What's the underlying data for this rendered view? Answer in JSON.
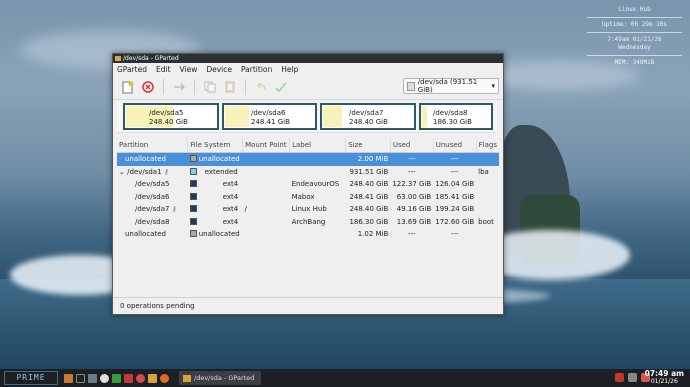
{
  "conky": {
    "host": "Linux Hub",
    "uptime": "Uptime: 0h 29m 10s",
    "time_date": "7:49am  01/21/26",
    "weekday": "Wednesday",
    "mem": "MEM: 340MiB"
  },
  "window": {
    "title": "/dev/sda - GParted",
    "menu": [
      "GParted",
      "Edit",
      "View",
      "Device",
      "Partition",
      "Help"
    ],
    "device_selector": "/dev/sda (931.51 GiB)"
  },
  "diskmap": [
    {
      "name": "/dev/sda5",
      "size": "248.40 GiB",
      "used_fraction": 0.49
    },
    {
      "name": "/dev/sda6",
      "size": "248.41 GiB",
      "used_fraction": 0.25
    },
    {
      "name": "/dev/sda7",
      "size": "248.40 GiB",
      "used_fraction": 0.2
    },
    {
      "name": "/dev/sda8",
      "size": "186.30 GiB",
      "used_fraction": 0.07
    }
  ],
  "table": {
    "headers": [
      "Partition",
      "File System",
      "Mount Point",
      "Label",
      "Size",
      "Used",
      "Unused",
      "Flags"
    ],
    "rows": [
      {
        "partition": "unallocated",
        "fs": "unallocated",
        "fs_color": "#a8a8a8",
        "mount": "",
        "label": "",
        "size": "2.00 MiB",
        "used": "---",
        "unused": "---",
        "flags": ""
      },
      {
        "partition": "/dev/sda1",
        "fs": "extended",
        "fs_color": "#7dd5e8",
        "mount": "",
        "label": "",
        "size": "931.51 GiB",
        "used": "---",
        "unused": "---",
        "flags": "lba"
      },
      {
        "partition": "/dev/sda5",
        "fs": "ext4",
        "fs_color": "#1f3a5a",
        "mount": "",
        "label": "EndeavourOS",
        "size": "248.40 GiB",
        "used": "122.37 GiB",
        "unused": "126.04 GiB",
        "flags": ""
      },
      {
        "partition": "/dev/sda6",
        "fs": "ext4",
        "fs_color": "#1f3a5a",
        "mount": "",
        "label": "Mabox",
        "size": "248.41 GiB",
        "used": "63.00 GiB",
        "unused": "185.41 GiB",
        "flags": ""
      },
      {
        "partition": "/dev/sda7",
        "fs": "ext4",
        "fs_color": "#1f3a5a",
        "mount": "/",
        "label": "Linux Hub",
        "size": "248.40 GiB",
        "used": "49.16 GiB",
        "unused": "199.24 GiB",
        "flags": ""
      },
      {
        "partition": "/dev/sda8",
        "fs": "ext4",
        "fs_color": "#1f3a5a",
        "mount": "",
        "label": "ArchBang",
        "size": "186.30 GiB",
        "used": "13.69 GiB",
        "unused": "172.60 GiB",
        "flags": "boot"
      },
      {
        "partition": "unallocated",
        "fs": "unallocated",
        "fs_color": "#a8a8a8",
        "mount": "",
        "label": "",
        "size": "1.02 MiB",
        "used": "---",
        "unused": "---",
        "flags": ""
      }
    ]
  },
  "status": "0 operations pending",
  "taskbar": {
    "launcher": "PRIME",
    "task_label": "/dev/sda - GParted",
    "clock_time": "07:49 am",
    "clock_date": "01/21/26"
  }
}
